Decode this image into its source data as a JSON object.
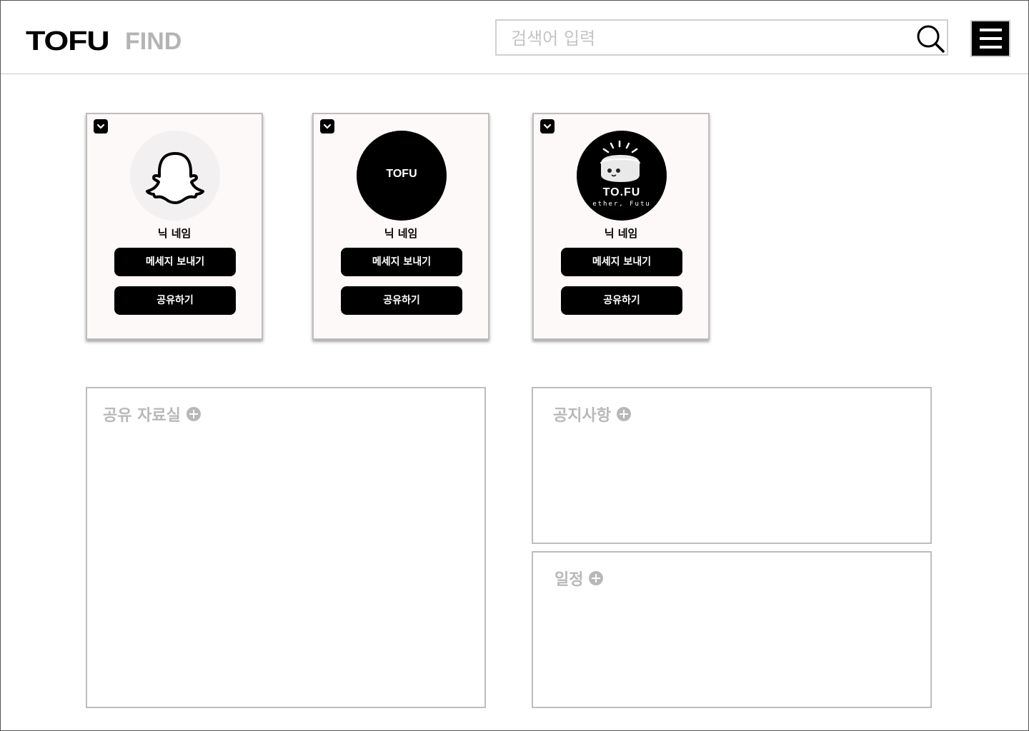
{
  "header": {
    "logo": "TOFU",
    "page_title": "FIND",
    "search_placeholder": "검색어 입력"
  },
  "cards": [
    {
      "nickname": "닉 네임",
      "message_label": "메세지 보내기",
      "share_label": "공유하기",
      "avatar": "ghost-icon"
    },
    {
      "nickname": "닉 네임",
      "message_label": "메세지 보내기",
      "share_label": "공유하기",
      "avatar": "tofu-logo",
      "avatar_text": "TOFU"
    },
    {
      "nickname": "닉 네임",
      "message_label": "메세지 보내기",
      "share_label": "공유하기",
      "avatar": "tofu-character-logo",
      "avatar_text": "TO.FU",
      "avatar_subtext": "ether, Futu"
    }
  ],
  "panels": {
    "shared_files": {
      "title": "공유 자료실"
    },
    "notices": {
      "title": "공지사항"
    },
    "schedule": {
      "title": "일정"
    }
  },
  "colors": {
    "accent": "#000000",
    "muted_text": "#b8b8b8",
    "card_background": "#fdf9f8",
    "border": "#bdbdbd"
  }
}
